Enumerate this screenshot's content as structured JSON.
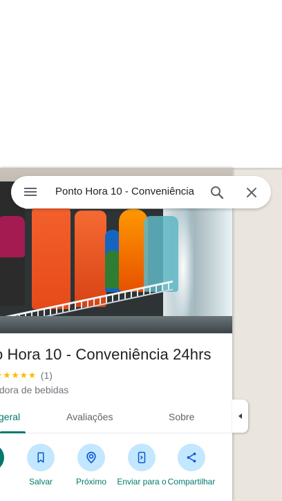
{
  "search": {
    "query": "Ponto Hora 10 - Conveniência",
    "menu_icon": "menu-icon",
    "search_icon": "search-icon",
    "close_icon": "close-icon"
  },
  "place": {
    "title": "o Hora 10 - Conveniência 24hrs",
    "stars": "★★★★★",
    "review_count": "(1)",
    "category": "uidora de bebidas",
    "rating": 5
  },
  "tabs": [
    {
      "label": "geral",
      "active": true
    },
    {
      "label": "Avaliações",
      "active": false
    },
    {
      "label": "Sobre",
      "active": false
    }
  ],
  "actions": [
    {
      "label": "s",
      "icon": "directions-icon"
    },
    {
      "label": "Salvar",
      "icon": "bookmark-icon"
    },
    {
      "label": "Próximo",
      "icon": "nearby-icon"
    },
    {
      "label": "Enviar para o",
      "icon": "send-to-phone-icon"
    },
    {
      "label": "Compartilhar",
      "icon": "share-icon"
    }
  ],
  "colors": {
    "accent": "#00796b",
    "action_circle": "#c2e7ff",
    "star": "#fbbc04"
  },
  "side_toggle": {
    "icon": "collapse-left-icon"
  }
}
